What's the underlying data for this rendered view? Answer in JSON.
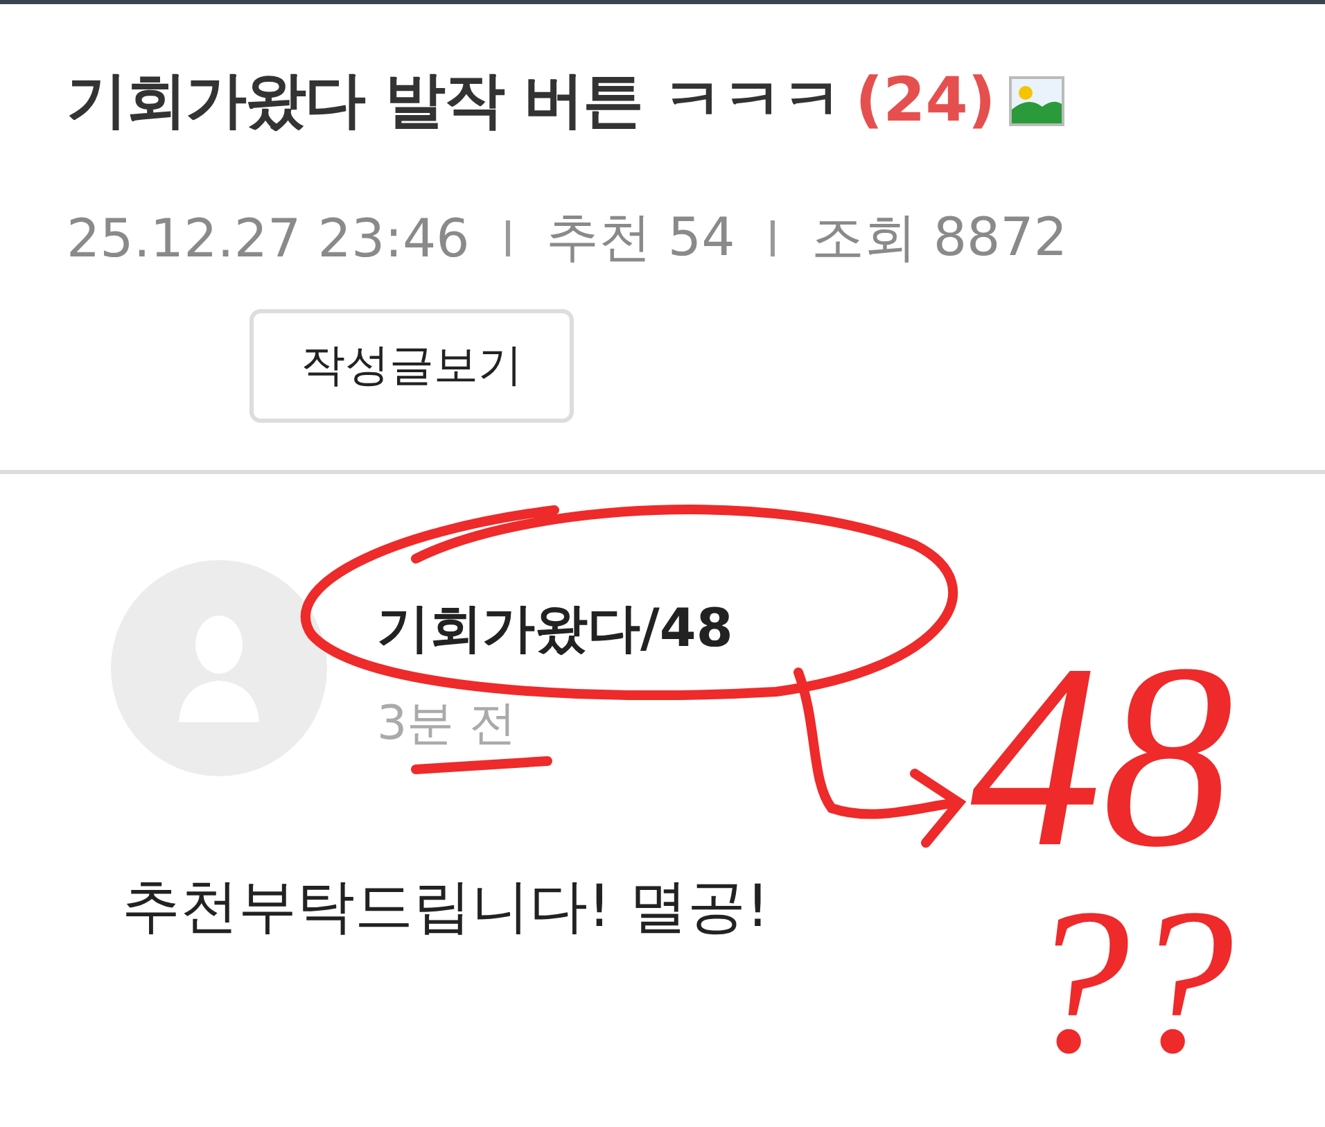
{
  "post": {
    "title": "기회가왔다 발작 버튼 ㅋㅋㅋ",
    "comment_count": "(24)",
    "has_image": true,
    "meta": [
      {
        "text": "25.12.27  23:46"
      },
      {
        "text": "추천 54"
      },
      {
        "text": "조회 8872"
      }
    ],
    "author_button": "작성글보기"
  },
  "comment": {
    "author": "기회가왔다/48",
    "time": "3분 전",
    "body": "추천부탁드립니다! 멸공!"
  },
  "annotations": [
    {
      "kind": "circle"
    },
    {
      "kind": "arrow"
    },
    {
      "kind": "text",
      "text": "48"
    },
    {
      "kind": "text",
      "text": "??"
    }
  ]
}
